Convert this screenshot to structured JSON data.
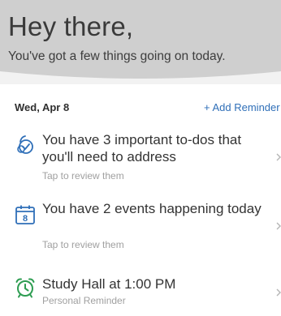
{
  "header": {
    "greeting": "Hey there,",
    "subtitle": "You've got a few things going on today."
  },
  "agenda": {
    "date": "Wed, Apr 8",
    "add_reminder_label": "+ Add Reminder",
    "items": [
      {
        "icon": "todo-icon",
        "title": "You have 3 important to-dos that you'll need to address",
        "subtitle": "Tap to review them"
      },
      {
        "icon": "calendar-icon",
        "calendar_day": "8",
        "title": "You have 2 events happening today",
        "subtitle": "Tap to review them"
      },
      {
        "icon": "alarm-clock-icon",
        "title": "Study Hall at 1:00 PM",
        "subtitle": "Personal Reminder"
      }
    ]
  },
  "colors": {
    "header_bg": "#cfcfcf",
    "page_bg": "#f2f2f2",
    "accent_blue": "#2f6fb8",
    "accent_green": "#2e9d52"
  }
}
